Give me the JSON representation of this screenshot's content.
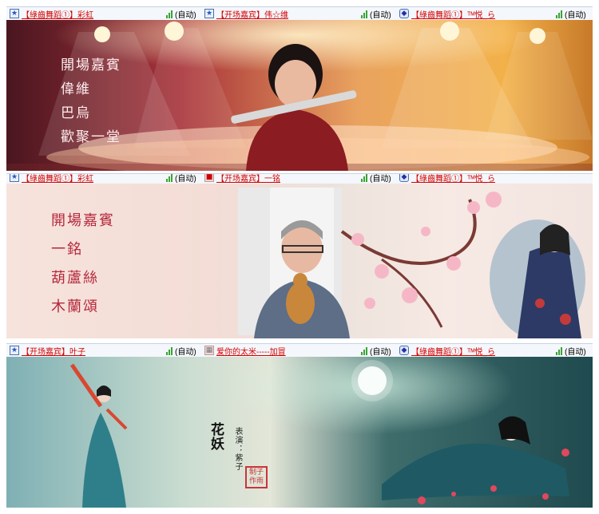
{
  "panels": [
    {
      "slots": [
        {
          "badge": "★",
          "name": "【綠齒舞蹈①】彩虹",
          "status": "(自动)"
        },
        {
          "badge": "★",
          "name": "【开场嘉宾】伟☆维",
          "status": "(自动)"
        },
        {
          "badge": "◆",
          "name": "【綠齒舞蹈①】ᵀᴹ悦_ら",
          "status": "(自动)"
        }
      ],
      "captions": [
        "開場嘉賓",
        "偉維",
        "巴烏",
        "歡聚一堂"
      ]
    },
    {
      "slots": [
        {
          "badge": "★",
          "name": "【綠齒舞蹈①】彩虹",
          "status": "(自动)"
        },
        {
          "badge": "■",
          "name": "【开场嘉宾】一铭",
          "status": "(自动)"
        },
        {
          "badge": "◆",
          "name": "【綠齒舞蹈①】ᵀᴹ悦_ら",
          "status": "(自动)"
        }
      ],
      "captions": [
        "開場嘉賓",
        "一銘",
        "葫蘆絲",
        "木蘭頌"
      ]
    },
    {
      "slots": [
        {
          "badge": "★",
          "name": "【开场嘉宾】叶子",
          "status": "(自动)"
        },
        {
          "badge": "▦",
          "name": "爱你的太米-----加冒",
          "status": "(自动)"
        },
        {
          "badge": "◆",
          "name": "【綠齒舞蹈①】ᵀᴹ悦_ら",
          "status": "(自动)"
        }
      ],
      "poster": {
        "title": "花妖",
        "performer": "表演：紫子",
        "seal": "制子作雨"
      }
    }
  ]
}
